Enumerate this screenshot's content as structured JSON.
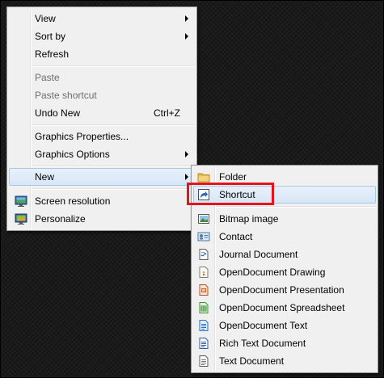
{
  "context_menu": {
    "items": [
      {
        "label": "View",
        "submenu": true
      },
      {
        "label": "Sort by",
        "submenu": true
      },
      {
        "label": "Refresh"
      },
      {
        "label": "Paste",
        "disabled": true
      },
      {
        "label": "Paste shortcut",
        "disabled": true
      },
      {
        "label": "Undo New",
        "shortcut": "Ctrl+Z"
      },
      {
        "label": "Graphics Properties..."
      },
      {
        "label": "Graphics Options",
        "submenu": true
      },
      {
        "label": "New",
        "submenu": true,
        "highlighted": true
      },
      {
        "label": "Screen resolution",
        "icon": "screen-resolution-icon"
      },
      {
        "label": "Personalize",
        "icon": "personalize-icon"
      }
    ]
  },
  "new_submenu": {
    "items": [
      {
        "label": "Folder",
        "icon": "folder-icon"
      },
      {
        "label": "Shortcut",
        "icon": "shortcut-icon",
        "highlighted": true
      },
      {
        "label": "Bitmap image",
        "icon": "bitmap-image-icon"
      },
      {
        "label": "Contact",
        "icon": "contact-icon"
      },
      {
        "label": "Journal Document",
        "icon": "journal-document-icon"
      },
      {
        "label": "OpenDocument Drawing",
        "icon": "opendocument-drawing-icon"
      },
      {
        "label": "OpenDocument Presentation",
        "icon": "opendocument-presentation-icon"
      },
      {
        "label": "OpenDocument Spreadsheet",
        "icon": "opendocument-spreadsheet-icon"
      },
      {
        "label": "OpenDocument Text",
        "icon": "opendocument-text-icon"
      },
      {
        "label": "Rich Text Document",
        "icon": "rich-text-document-icon"
      },
      {
        "label": "Text Document",
        "icon": "text-document-icon"
      }
    ]
  },
  "colors": {
    "highlight_border": "#e3141b",
    "hover_fill": "#d7e6f6",
    "menu_background": "#f0f0f0"
  }
}
